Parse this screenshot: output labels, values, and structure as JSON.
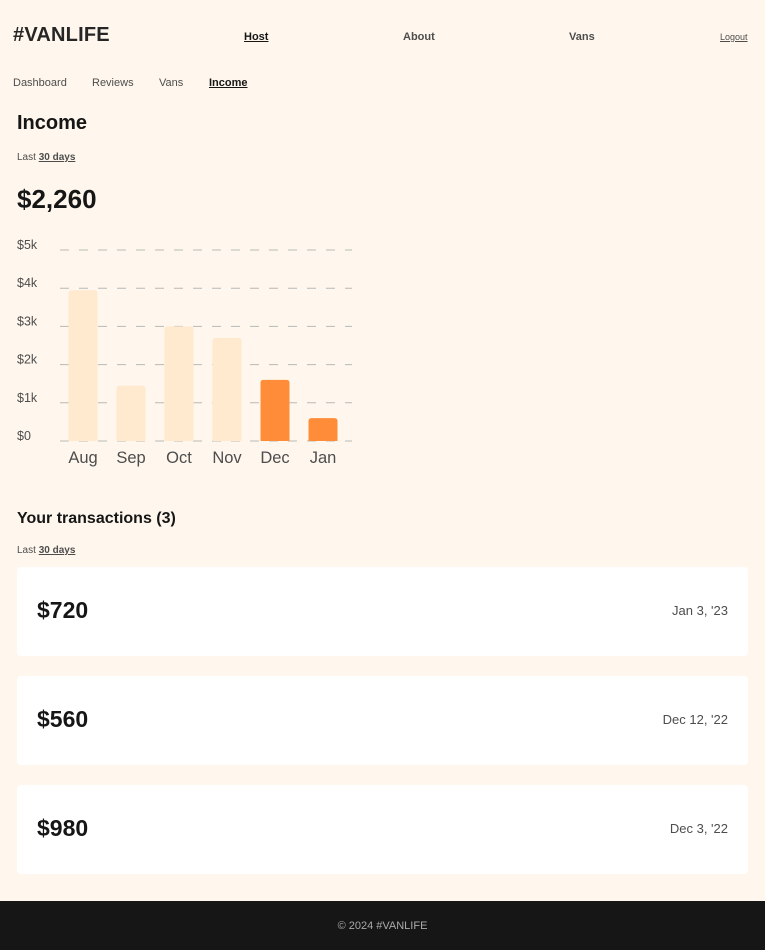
{
  "header": {
    "logo": "#VANLIFE",
    "nav": {
      "host": "Host",
      "about": "About",
      "vans": "Vans",
      "logout": "Logout"
    }
  },
  "subnav": {
    "dashboard": "Dashboard",
    "reviews": "Reviews",
    "vans": "Vans",
    "income": "Income"
  },
  "income": {
    "title": "Income",
    "period_prefix": "Last",
    "period_value": "30 days",
    "total": "$2,260"
  },
  "chart_data": {
    "type": "bar",
    "categories": [
      "Aug",
      "Sep",
      "Oct",
      "Nov",
      "Dec",
      "Jan"
    ],
    "values": [
      3950,
      1450,
      3000,
      2700,
      1600,
      600
    ],
    "highlighted": [
      false,
      false,
      false,
      false,
      true,
      true
    ],
    "ytick_labels": [
      "$0",
      "$1k",
      "$2k",
      "$3k",
      "$4k",
      "$5k"
    ],
    "yticks": [
      0,
      1000,
      2000,
      3000,
      4000,
      5000
    ],
    "ylim": [
      0,
      5000
    ],
    "grid": "dashed horizontal",
    "colors": {
      "bar": "#FFEAD0",
      "bar_highlight": "#FF8C38",
      "grid": "#B8B8B8",
      "tick": "#4D4D4D"
    },
    "title": "",
    "xlabel": "",
    "ylabel": ""
  },
  "transactions": {
    "title": "Your transactions (3)",
    "period_prefix": "Last",
    "period_value": "30 days",
    "items": [
      {
        "amount": "$720",
        "date": "Jan 3, '23"
      },
      {
        "amount": "$560",
        "date": "Dec 12, '22"
      },
      {
        "amount": "$980",
        "date": "Dec 3, '22"
      }
    ]
  },
  "footer": {
    "text": "© 2024 #VANLIFE"
  }
}
